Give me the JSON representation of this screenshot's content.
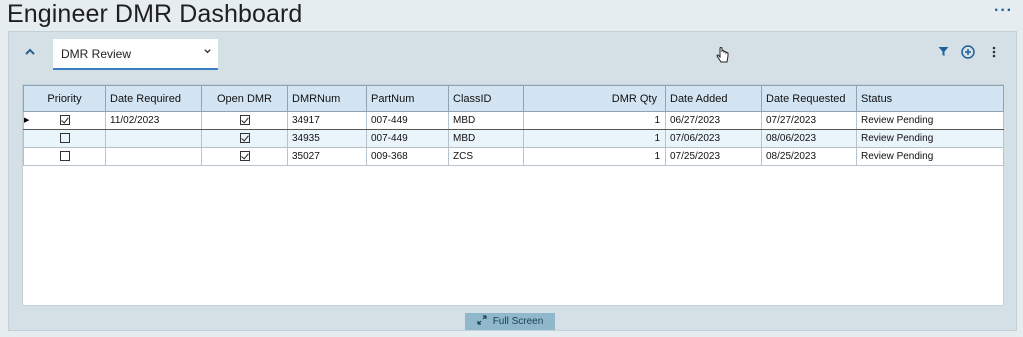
{
  "page": {
    "title": "Engineer DMR Dashboard"
  },
  "panel": {
    "view_select": "DMR Review"
  },
  "grid": {
    "columns": [
      "Priority",
      "Date Required",
      "Open DMR",
      "DMRNum",
      "PartNum",
      "ClassID",
      "DMR Qty",
      "Date Added",
      "Date Requested",
      "Status"
    ],
    "rows": [
      {
        "priority": true,
        "date_required": "11/02/2023",
        "open_dmr": true,
        "dmrnum": "34917",
        "partnum": "007-449",
        "classid": "MBD",
        "qty": "1",
        "date_added": "06/27/2023",
        "date_requested": "07/27/2023",
        "status": "Review Pending"
      },
      {
        "priority": false,
        "date_required": "",
        "open_dmr": true,
        "dmrnum": "34935",
        "partnum": "007-449",
        "classid": "MBD",
        "qty": "1",
        "date_added": "07/06/2023",
        "date_requested": "08/06/2023",
        "status": "Review Pending"
      },
      {
        "priority": false,
        "date_required": "",
        "open_dmr": true,
        "dmrnum": "35027",
        "partnum": "009-368",
        "classid": "ZCS",
        "qty": "1",
        "date_added": "07/25/2023",
        "date_requested": "08/25/2023",
        "status": "Review Pending"
      }
    ]
  },
  "footer": {
    "fullscreen_label": "Full Screen"
  },
  "icons": {
    "more_top": "ellipsis-icon",
    "collapse": "chevron-up-icon",
    "filter": "filter-icon",
    "add": "plus-circle-icon",
    "more_panel": "vertical-ellipsis-icon",
    "expand": "expand-icon"
  },
  "colors": {
    "accent": "#1f5e9c",
    "header_bg": "#d3e4f2",
    "panel_bg": "#d5e0e6",
    "fullscreen_bg": "#8fb8cc"
  }
}
